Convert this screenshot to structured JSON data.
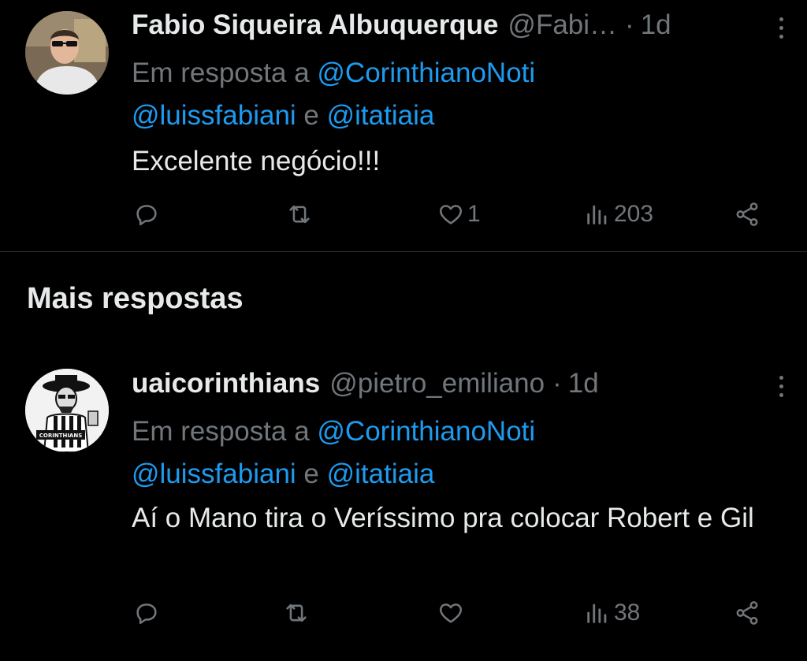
{
  "tweets": [
    {
      "display_name": "Fabio Siqueira Albuquerque",
      "handle": "@Fabi…",
      "dot": "·",
      "time": "1d",
      "reply_prefix": "Em resposta a",
      "mentions": [
        "@CorinthianoNoti",
        "@luissfabiani",
        "@itatiaia"
      ],
      "reply_conj": "e",
      "text": "Excelente negócio!!!",
      "likes": "1",
      "views": "203"
    },
    {
      "display_name": "uaicorinthians",
      "handle": "@pietro_emiliano",
      "dot": "·",
      "time": "1d",
      "reply_prefix": "Em resposta a",
      "mentions": [
        "@CorinthianoNoti",
        "@luissfabiani",
        "@itatiaia"
      ],
      "reply_conj": "e",
      "text": "Aí o Mano tira o Veríssimo pra colocar Robert e Gil",
      "likes": "",
      "views": "38",
      "avatar_caption": "CORINTHIANS"
    }
  ],
  "section_title": "Mais respostas",
  "icons": {
    "reply": "reply-icon",
    "retweet": "retweet-icon",
    "like": "heart-icon",
    "views": "views-icon",
    "share": "share-icon",
    "more": "more-icon"
  },
  "colors": {
    "background": "#000000",
    "text": "#e7e9ea",
    "muted": "#71767b",
    "link": "#1d9bf0",
    "divider": "#2f3336"
  }
}
